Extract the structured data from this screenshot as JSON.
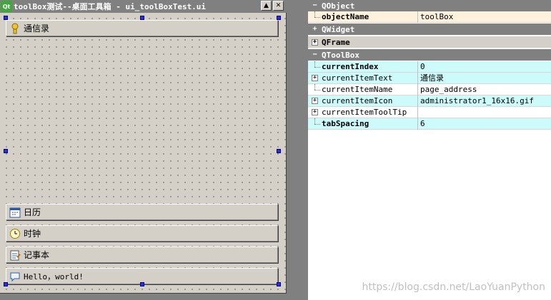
{
  "window": {
    "title": "toolBox测试--桌面工具箱 - ui_toolBoxTest.ui",
    "logo": "Qt",
    "minimize_glyph": "▲",
    "close_glyph": "✕"
  },
  "toolbox": {
    "items": [
      {
        "label": "通信录",
        "icon": "address-book-icon"
      },
      {
        "label": "日历",
        "icon": "calendar-icon"
      },
      {
        "label": "时钟",
        "icon": "clock-icon"
      },
      {
        "label": "记事本",
        "icon": "notepad-icon"
      },
      {
        "label": "Hello，world!",
        "icon": "speech-bubble-icon"
      }
    ]
  },
  "property_editor": {
    "groups": [
      {
        "name": "QObject",
        "expanded": true
      },
      {
        "name": "QWidget",
        "expanded": false
      },
      {
        "name": "QFrame",
        "expanded": false
      },
      {
        "name": "QToolBox",
        "expanded": true
      }
    ],
    "properties": [
      {
        "name": "objectName",
        "value": "toolBox"
      },
      {
        "name": "currentIndex",
        "value": "0"
      },
      {
        "name": "currentItemText",
        "value": "通信录"
      },
      {
        "name": "currentItemName",
        "value": "page_address"
      },
      {
        "name": "currentItemIcon",
        "value": "administrator1_16x16.gif"
      },
      {
        "name": "currentItemToolTip",
        "value": ""
      },
      {
        "name": "tabSpacing",
        "value": "6"
      }
    ],
    "expand_glyph": "+",
    "collapse_glyph": "−"
  },
  "watermark": "https://blog.csdn.net/LaoYuanPython",
  "colors": {
    "title_bar": "#808080",
    "form_bg": "#d4d0c8",
    "selection_handle": "#3030d0",
    "prop_peach": "#fff1dc",
    "prop_cyan": "#cdfbfb"
  }
}
